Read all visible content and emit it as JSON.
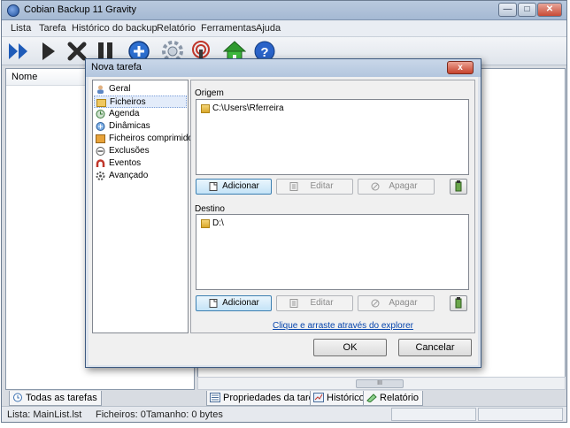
{
  "window": {
    "title": "Cobian Backup 11 Gravity"
  },
  "menu": [
    "Lista",
    "Tarefa",
    "Histórico do backup",
    "Relatório",
    "Ferramentas",
    "Ajuda"
  ],
  "toolbar": {
    "icons": [
      "run-all-icon",
      "run-icon",
      "stop-icon",
      "pause-icon",
      "add-task-icon",
      "settings-icon",
      "remote-icon",
      "home-icon",
      "help-icon"
    ]
  },
  "left_panel": {
    "header": "Nome",
    "tab": "Todas as tarefas"
  },
  "right_tabs": [
    "Propriedades da tarefa",
    "Histórico",
    "Relatório"
  ],
  "scrollbar": {
    "thumb_text": "III"
  },
  "status": {
    "list": "Lista: MainList.lst",
    "files": "Ficheiros: 0",
    "size": "Tamanho: 0 bytes"
  },
  "dialog": {
    "title": "Nova tarefa",
    "close": "x",
    "nav": [
      "Geral",
      "Ficheiros",
      "Agenda",
      "Dinâmicas",
      "Ficheiros comprimidos",
      "Exclusões",
      "Eventos",
      "Avançado"
    ],
    "selected_nav": "Ficheiros",
    "source": {
      "label": "Origem",
      "items": [
        "C:\\Users\\Rferreira"
      ],
      "add": "Adicionar",
      "edit": "Editar",
      "delete": "Apagar"
    },
    "destination": {
      "label": "Destino",
      "items": [
        "D:\\"
      ],
      "add": "Adicionar",
      "edit": "Editar",
      "delete": "Apagar"
    },
    "explorer_link": "Clique e arraste através do explorer",
    "ok": "OK",
    "cancel": "Cancelar"
  },
  "colors": {
    "accent": "#1e5bb8",
    "title_bar": "#b3c6de",
    "link": "#0645ad"
  }
}
